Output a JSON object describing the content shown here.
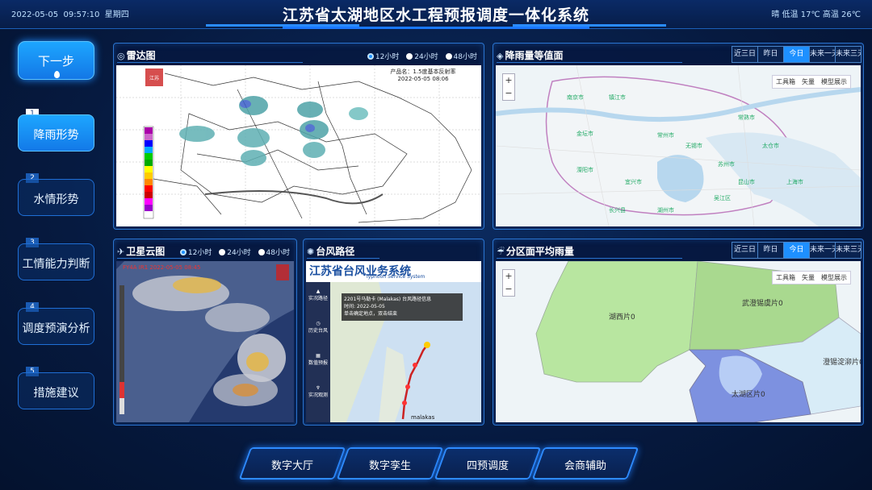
{
  "header": {
    "date": "2022-05-05",
    "time": "09:57:10",
    "weekday": "星期四",
    "title": "江苏省太湖地区水工程预报调度一体化系统",
    "weather": "晴 低温 17℃ 高温 26℃"
  },
  "sidebar": {
    "next_label": "下一步",
    "steps": [
      {
        "num": "1",
        "label": "降雨形势"
      },
      {
        "num": "2",
        "label": "水情形势"
      },
      {
        "num": "3",
        "label": "工情能力判断"
      },
      {
        "num": "4",
        "label": "调度预演分析"
      },
      {
        "num": "5",
        "label": "措施建议"
      }
    ]
  },
  "radar": {
    "title": "雷达图",
    "options": [
      "12小时",
      "24小时",
      "48小时"
    ],
    "selected": "12小时",
    "product": "产品名：1.5度基本反射率",
    "time": "2022-05-05 08:06",
    "legend": [
      "70",
      "65",
      "60",
      "55",
      "50",
      "45",
      "40",
      "35",
      "30",
      "25",
      "20",
      "15",
      "10",
      "5"
    ]
  },
  "rain_contour": {
    "title": "降雨量等值面",
    "tabs": [
      "近三日",
      "昨日",
      "今日",
      "未来一天",
      "未来三天"
    ],
    "selected": "今日",
    "tools": [
      "工具箱",
      "矢量",
      "模型展示"
    ],
    "labels": [
      "南京市",
      "镇江市",
      "常州市",
      "无锡市",
      "苏州市",
      "溧阳市",
      "宜兴市",
      "湖州市",
      "上海市",
      "常熟市",
      "太仓市",
      "昆山市",
      "吴江区",
      "长兴县",
      "金坛市"
    ]
  },
  "satellite": {
    "title": "卫星云图",
    "options": [
      "12小时",
      "24小时",
      "48小时"
    ],
    "selected": "12小时",
    "stamp": "FY4A IR1 2022-05-05 08:45"
  },
  "typhoon": {
    "title": "台风路径",
    "system_title": "江苏省台风业务系统",
    "system_en": "Typhoon Service System",
    "popup_title": "2201号马勒卡 (Malakas) 台风路径信息",
    "popup_line1": "时间: 2022-05-05",
    "popup_line2": "单击确定地点，双击结束",
    "menu": [
      "实况路径",
      "历史台风",
      "数值预报",
      "实况观测"
    ],
    "name_label": "malakas"
  },
  "zone_rain": {
    "title": "分区面平均雨量",
    "tabs": [
      "近三日",
      "昨日",
      "今日",
      "未来一天",
      "未来三天"
    ],
    "selected": "今日",
    "tools": [
      "工具箱",
      "矢量",
      "模型展示"
    ],
    "zones": [
      "湖西片0",
      "武澄锡虞片0",
      "澄锡淀泖片0",
      "太湖区片0"
    ]
  },
  "bottom_nav": [
    "数字大厅",
    "数字孪生",
    "四预调度",
    "会商辅助"
  ],
  "colors": {
    "accent": "#1e90ff",
    "panel_border": "#2a74d0",
    "zone_green": "#b8e6a0",
    "zone_blue": "#7d91e0"
  }
}
